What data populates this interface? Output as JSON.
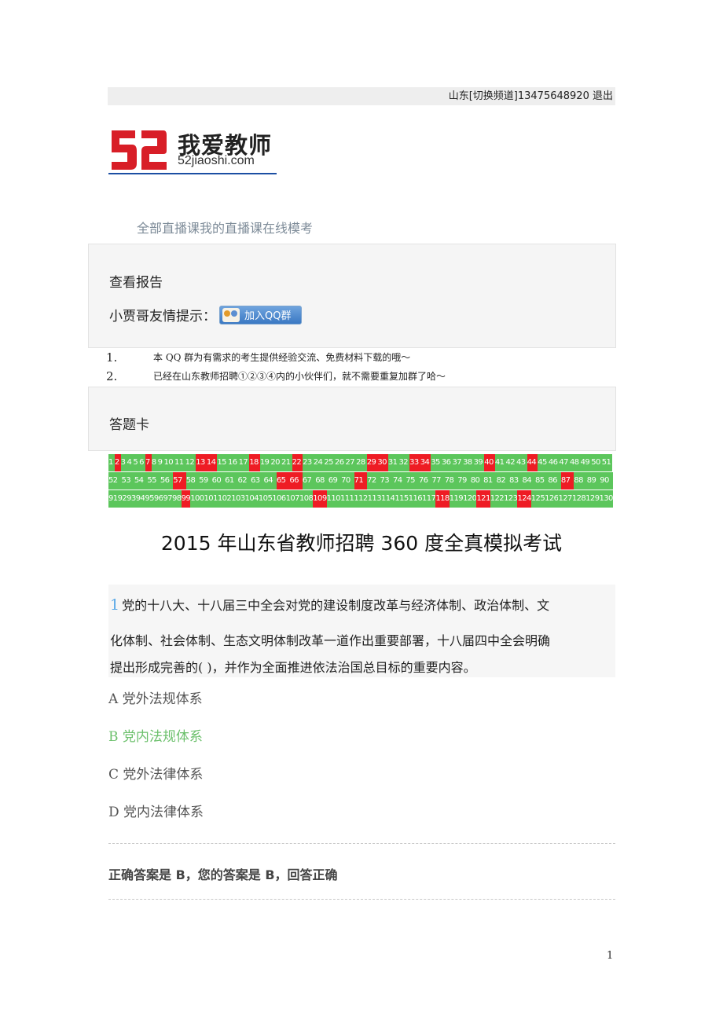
{
  "topbar": {
    "region": "山东",
    "switch_channel": "[切换频道]",
    "phone": "13475648920",
    "logout": "退出"
  },
  "logo": {
    "title": "我爱教师",
    "url": "52jiaoshi.com"
  },
  "nav": {
    "all_live": "全部直播课",
    "my_live": "我的直播课",
    "mock_exam": "在线模考"
  },
  "report": {
    "title": "查看报告",
    "tip_label": "小贾哥友情提示：",
    "qq_button": "加入QQ群"
  },
  "notes": [
    {
      "num": "1.",
      "text": "本 QQ 群为有需求的考生提供经验交流、免费材料下载的哦～"
    },
    {
      "num": "2.",
      "text": "已经在山东教师招聘①②③④内的小伙伴们，就不需要重复加群了哈～"
    }
  ],
  "answer_card": {
    "title": "答题卡",
    "wrong": [
      2,
      7,
      13,
      14,
      18,
      22,
      29,
      30,
      33,
      34,
      40,
      44,
      57,
      65,
      66,
      71,
      87,
      99,
      109,
      118,
      121,
      124
    ],
    "total": 130
  },
  "exam": {
    "title": "2015 年山东省教师招聘 360 度全真模拟考试"
  },
  "question": {
    "number": "1",
    "lines": [
      "党的十八大、十八届三中全会对党的建设制度改革与经济体制、政治体制、文",
      "化体制、社会体制、生态文明体制改革一道作出重要部署，十八届四中全会明确",
      "提出形成完善的( )，并作为全面推进依法治国总目标的重要内容。"
    ],
    "options": [
      {
        "text": "A 党外法规体系",
        "correct": false
      },
      {
        "text": "B 党内法规体系",
        "correct": true
      },
      {
        "text": "C 党外法律体系",
        "correct": false
      },
      {
        "text": "D 党内法律体系",
        "correct": false
      }
    ]
  },
  "result": {
    "text": "正确答案是 B，您的答案是 B，回答正确"
  },
  "footer": {
    "page": "1"
  },
  "colors": {
    "correct": "#5cc65c",
    "wrong": "#ee1c24",
    "question_number": "#5aa9e6",
    "correct_option": "#6cc06c"
  }
}
